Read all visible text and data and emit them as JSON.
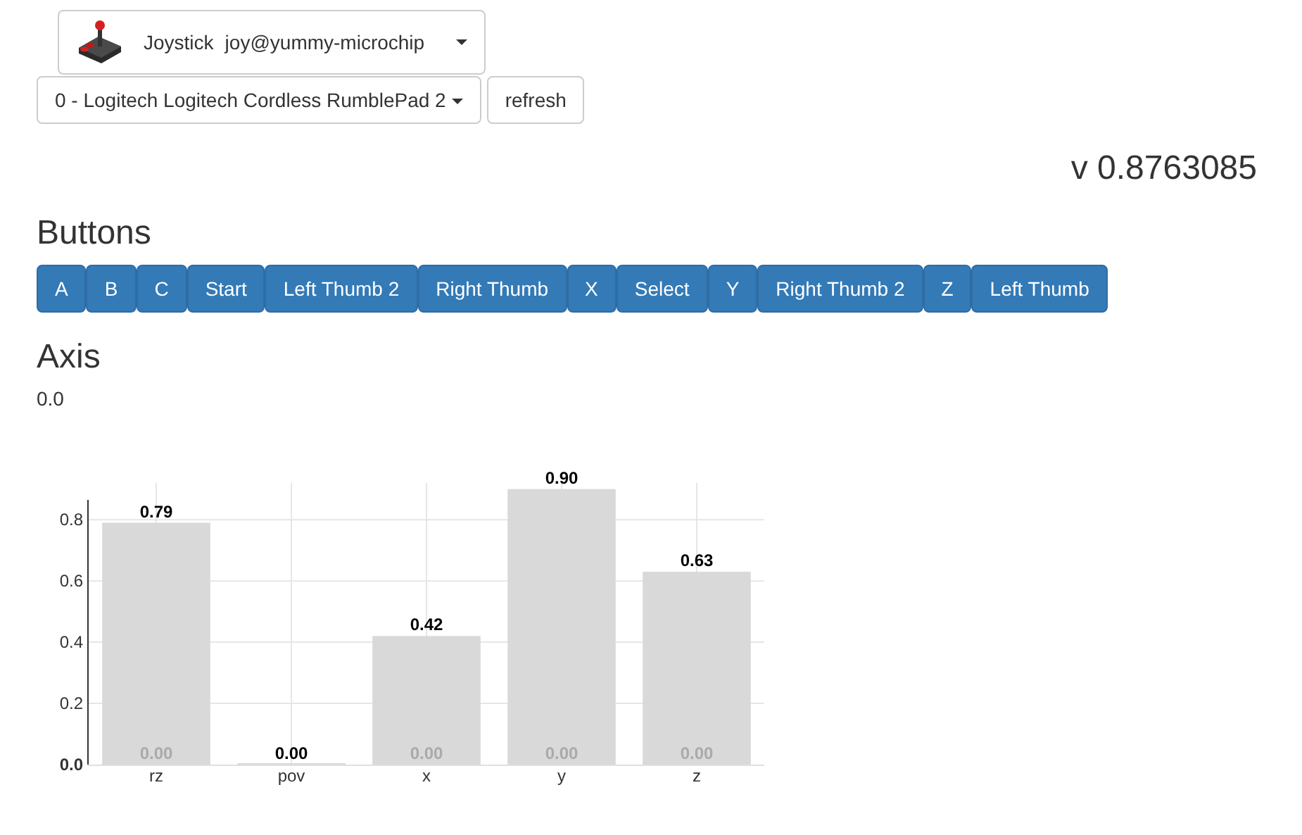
{
  "device_picker": {
    "label": "Joystick",
    "host": "joy@yummy-microchip"
  },
  "controller_select": {
    "value": "0 - Logitech Logitech Cordless RumblePad 2"
  },
  "refresh_button": "refresh",
  "version": "v 0.8763085",
  "buttons_heading": "Buttons",
  "buttons": [
    "A",
    "B",
    "C",
    "Start",
    "Left Thumb 2",
    "Right Thumb",
    "X",
    "Select",
    "Y",
    "Right Thumb 2",
    "Z",
    "Left Thumb"
  ],
  "axis_heading": "Axis",
  "axis_value": "0.0",
  "chart_data": {
    "type": "bar",
    "categories": [
      "rz",
      "pov",
      "x",
      "y",
      "z"
    ],
    "series": [
      {
        "color": "#d9d9d9",
        "values": [
          0.79,
          0,
          0.42,
          0.9,
          0.63
        ],
        "value_labels": [
          "0.79",
          "0.00",
          "0.42",
          "0.90",
          "0.63"
        ]
      },
      {
        "color": "#d9d9d9",
        "values": [
          0,
          0,
          0,
          0,
          0
        ],
        "value_labels": [
          "0.00",
          null,
          "0.00",
          "0.00",
          "0.00"
        ]
      }
    ],
    "grid": true,
    "ylim": [
      0,
      0.92
    ],
    "yticks": [
      {
        "value": 0,
        "label": "0.0"
      },
      {
        "value": 0.2,
        "label": "0.2"
      },
      {
        "value": 0.4,
        "label": "0.4"
      },
      {
        "value": 0.6,
        "label": "0.6"
      },
      {
        "value": 0.8,
        "label": "0.8"
      }
    ],
    "stacked": false
  }
}
